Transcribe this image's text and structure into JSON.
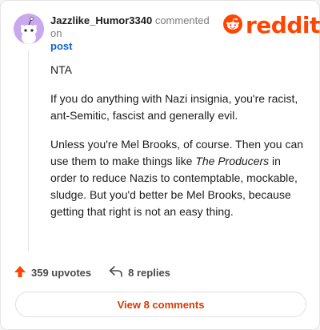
{
  "header": {
    "username": "Jazzlike_Humor3340",
    "commented_on": "commented on",
    "post_link": "post"
  },
  "brand": {
    "logo_text": "reddit",
    "color": "#ff4500"
  },
  "comment": {
    "p1": "NTA",
    "p2": "If you do anything with Nazi insignia, you're racist, ant-Semitic, fascist and generally evil.",
    "p3_before": "Unless you're Mel Brooks, of course. Then you can use them to make things like ",
    "p3_italic": "The Producers",
    "p3_after": " in order to reduce Nazis to contemptable, mockable, sludge. But you'd better be Mel Brooks, because getting that right is not an easy thing."
  },
  "actions": {
    "upvotes": "359 upvotes",
    "replies": "8 replies"
  },
  "view_comments": "View 8 comments",
  "icons": [
    "snoo-avatar-icon",
    "reddit-snoo-icon",
    "upvote-arrow-icon",
    "reply-icon"
  ]
}
